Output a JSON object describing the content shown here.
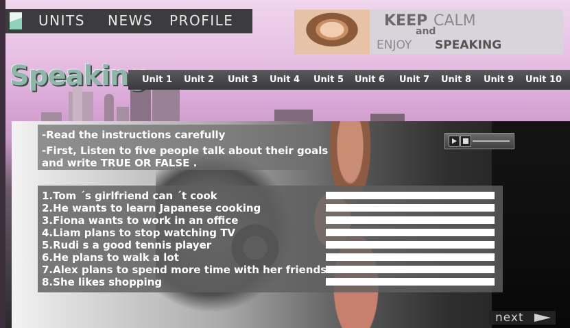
{
  "top_nav": {
    "items": [
      "UNITS",
      "NEWS",
      "PROFILE"
    ]
  },
  "banner": {
    "keep": "KEEP",
    "calm": "CALM",
    "and": "and",
    "enjoy": "ENJOY",
    "speaking": "SPEAKING"
  },
  "page_title": "Speaking",
  "units": [
    "Unit 1",
    "Unit 2",
    "Unit 3",
    "Unit 4",
    "Unit 5",
    "Unit 6",
    "Unit 7",
    "Unit 8",
    "Unit 9",
    "Unit 10"
  ],
  "instructions": {
    "line1": "-Read the instructions carefully",
    "line2": "-First, Listen to five people talk about their goals",
    "line3": "and write TRUE OR FALSE ."
  },
  "statements": [
    "1.Tom ´s girlfriend can ´t cook",
    "2.He wants to learn Japanese cooking",
    "3.Fiona wants to work in an office",
    "4.Liam plans to stop watching TV",
    "5.Rudi  s a good tennis player",
    "6.He plans to walk a lot",
    "7.Alex plans to spend more time with her friends",
    "8.She likes shopping"
  ],
  "answers": [
    "",
    "",
    "",
    "",
    "",
    "",
    "",
    ""
  ],
  "next_label": "next",
  "colors": {
    "title": "#8fb6a8",
    "nav_bg": "#3c3c3e",
    "unit_bar_bg": "#4a4a4e",
    "overlay": "#5f5f5f"
  }
}
